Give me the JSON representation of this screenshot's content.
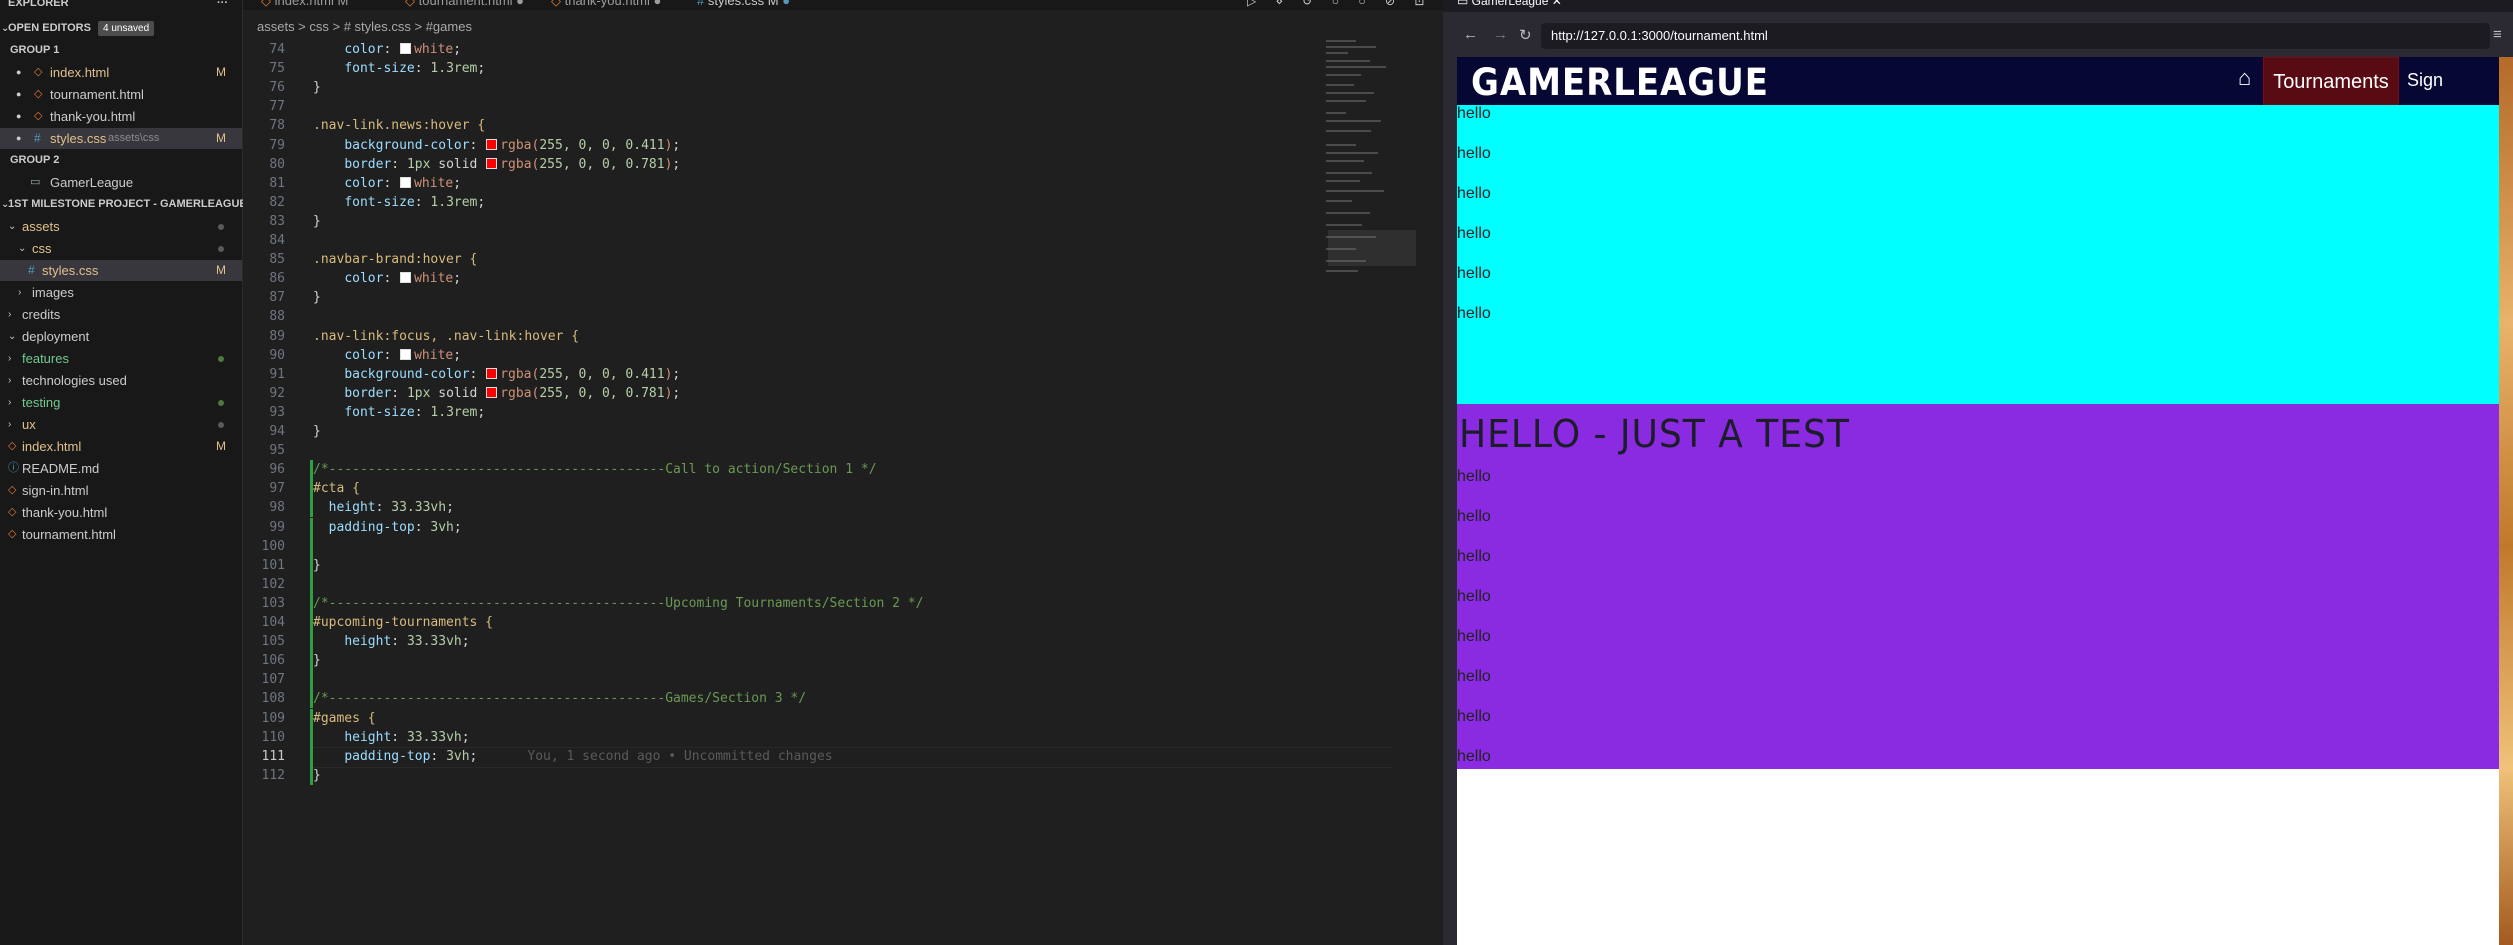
{
  "sidebar": {
    "explorer_title": "EXPLORER",
    "open_editors_label": "OPEN EDITORS",
    "unsaved_badge": "4 unsaved",
    "group1_label": "GROUP 1",
    "group2_label": "GROUP 2",
    "open_editors": [
      {
        "name": "index.html",
        "marker": "M",
        "type": "html"
      },
      {
        "name": "tournament.html",
        "marker": "",
        "type": "html"
      },
      {
        "name": "thank-you.html",
        "marker": "",
        "type": "html"
      },
      {
        "name": "styles.css",
        "path": "assets\\css",
        "marker": "M",
        "type": "css"
      }
    ],
    "group2_item": "GamerLeague",
    "project_label": "1ST MILESTONE PROJECT - GAMERLEAGUE",
    "tree": [
      {
        "name": "assets",
        "kind": "folder-open",
        "status": "dot"
      },
      {
        "name": "css",
        "kind": "folder-open",
        "status": "dot"
      },
      {
        "name": "styles.css",
        "kind": "css",
        "status": "M"
      },
      {
        "name": "images",
        "kind": "folder",
        "status": ""
      },
      {
        "name": "credits",
        "kind": "folder",
        "status": ""
      },
      {
        "name": "deployment",
        "kind": "folder-open",
        "status": ""
      },
      {
        "name": "features",
        "kind": "folder",
        "status": "green"
      },
      {
        "name": "technologies used",
        "kind": "folder",
        "status": ""
      },
      {
        "name": "testing",
        "kind": "folder",
        "status": "green"
      },
      {
        "name": "ux",
        "kind": "folder",
        "status": "dot"
      },
      {
        "name": "index.html",
        "kind": "html",
        "status": "M"
      },
      {
        "name": "README.md",
        "kind": "info",
        "status": ""
      },
      {
        "name": "sign-in.html",
        "kind": "html",
        "status": ""
      },
      {
        "name": "thank-you.html",
        "kind": "html",
        "status": ""
      },
      {
        "name": "tournament.html",
        "kind": "html",
        "status": ""
      }
    ]
  },
  "editor": {
    "tabs": [
      "index.html M",
      "tournament.html",
      "thank-you.html",
      "styles.css M"
    ],
    "breadcrumb": "assets > css > # styles.css > #games",
    "lens_text": "You, 1 second ago • Uncommitted changes",
    "lines": [
      {
        "n": "74",
        "code": "    color: white;"
      },
      {
        "n": "75",
        "code": "    font-size: 1.3rem;"
      },
      {
        "n": "76",
        "code": "}"
      },
      {
        "n": "77",
        "code": ""
      },
      {
        "n": "78",
        "code": ".nav-link.news:hover {"
      },
      {
        "n": "79",
        "code": "    background-color: rgba(255, 0, 0, 0.411);"
      },
      {
        "n": "80",
        "code": "    border: 1px solid rgba(255, 0, 0, 0.781);"
      },
      {
        "n": "81",
        "code": "    color: white;"
      },
      {
        "n": "82",
        "code": "    font-size: 1.3rem;"
      },
      {
        "n": "83",
        "code": "}"
      },
      {
        "n": "84",
        "code": ""
      },
      {
        "n": "85",
        "code": ".navbar-brand:hover {"
      },
      {
        "n": "86",
        "code": "    color: white;"
      },
      {
        "n": "87",
        "code": "}"
      },
      {
        "n": "88",
        "code": ""
      },
      {
        "n": "89",
        "code": ".nav-link:focus, .nav-link:hover {"
      },
      {
        "n": "90",
        "code": "    color: white;"
      },
      {
        "n": "91",
        "code": "    background-color: rgba(255, 0, 0, 0.411);"
      },
      {
        "n": "92",
        "code": "    border: 1px solid rgba(255, 0, 0, 0.781);"
      },
      {
        "n": "93",
        "code": "    font-size: 1.3rem;"
      },
      {
        "n": "94",
        "code": "}"
      },
      {
        "n": "95",
        "code": ""
      },
      {
        "n": "96",
        "code": "/*-------------------------------------------Call to action/Section 1 */"
      },
      {
        "n": "97",
        "code": "#cta {"
      },
      {
        "n": "98",
        "code": "  height: 33.33vh;"
      },
      {
        "n": "99",
        "code": "  padding-top: 3vh;"
      },
      {
        "n": "100",
        "code": ""
      },
      {
        "n": "101",
        "code": "}"
      },
      {
        "n": "102",
        "code": ""
      },
      {
        "n": "103",
        "code": "/*-------------------------------------------Upcoming Tournaments/Section 2 */"
      },
      {
        "n": "104",
        "code": "#upcoming-tournaments {"
      },
      {
        "n": "105",
        "code": "    height: 33.33vh;"
      },
      {
        "n": "106",
        "code": "}"
      },
      {
        "n": "107",
        "code": ""
      },
      {
        "n": "108",
        "code": "/*-------------------------------------------Games/Section 3 */"
      },
      {
        "n": "109",
        "code": "#games {"
      },
      {
        "n": "110",
        "code": "    height: 33.33vh;"
      },
      {
        "n": "111",
        "code": "    padding-top: 3vh;"
      },
      {
        "n": "112",
        "code": "}"
      }
    ]
  },
  "browser": {
    "tab_title": "GamerLeague",
    "url": "http://127.0.0.1:3000/tournament.html",
    "brand": "GAMERLEAGUE",
    "nav_tournaments": "Tournaments",
    "nav_sign": "Sign in/Join",
    "hello": "hello",
    "heading": "HELLO - JUST A TEST",
    "cta_color": "#00ffff",
    "upcoming_color": "#8a2be2",
    "navbar_color": "#070734",
    "active_nav_color": "#590b14"
  }
}
